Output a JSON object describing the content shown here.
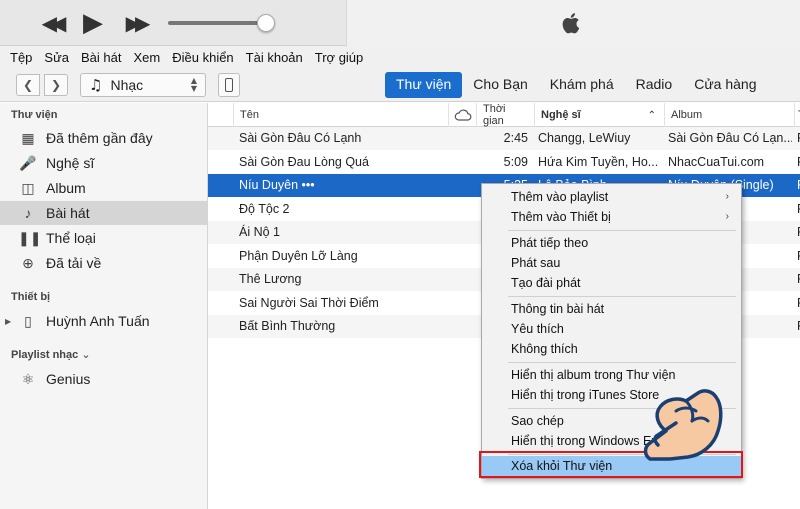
{
  "player": {
    "controls": [
      "rewind-icon",
      "play-icon",
      "fast-forward-icon"
    ],
    "volume_level": 0.88
  },
  "menu": [
    "Tệp",
    "Sửa",
    "Bài hát",
    "Xem",
    "Điều khiển",
    "Tài khoản",
    "Trợ giúp"
  ],
  "toolbar": {
    "media_type": "Nhạc",
    "tabs": [
      {
        "label": "Thư viện",
        "active": true
      },
      {
        "label": "Cho Bạn",
        "active": false
      },
      {
        "label": "Khám phá",
        "active": false
      },
      {
        "label": "Radio",
        "active": false
      },
      {
        "label": "Cửa hàng",
        "active": false
      }
    ]
  },
  "sidebar": {
    "library_title": "Thư viện",
    "library_items": [
      {
        "label": "Đã thêm gần đây",
        "icon": "calendar-icon"
      },
      {
        "label": "Nghệ sĩ",
        "icon": "microphone-icon"
      },
      {
        "label": "Album",
        "icon": "album-icon"
      },
      {
        "label": "Bài hát",
        "icon": "music-note-icon",
        "active": true
      },
      {
        "label": "Thể loại",
        "icon": "genre-icon"
      },
      {
        "label": "Đã tải về",
        "icon": "download-icon"
      }
    ],
    "devices_title": "Thiết bị",
    "device": {
      "label": "Huỳnh Anh Tuấn",
      "icon": "phone-icon"
    },
    "playlists_title": "Playlist nhạc",
    "playlists": [
      {
        "label": "Genius",
        "icon": "genius-icon"
      }
    ]
  },
  "table": {
    "columns": {
      "name": "Tên",
      "time": "Thời gian",
      "artist": "Nghệ sĩ",
      "album": "Album",
      "extra": "T"
    },
    "rows": [
      {
        "name": "Sài Gòn Đâu Có Lạnh",
        "time": "2:45",
        "artist": "Changg, LeWiuy",
        "album": "Sài Gòn Đâu Có Lạn...",
        "extra": "P"
      },
      {
        "name": "Sài Gòn Đau Lòng Quá",
        "time": "5:09",
        "artist": "Hứa Kim Tuyền, Ho...",
        "album": "NhacCuaTui.com",
        "extra": "P"
      },
      {
        "name": "Níu Duyên •••",
        "time": "5:35",
        "artist": "Lê Bảo Bình",
        "album": "Níu Duyên (Single)",
        "extra": "P",
        "selected": true
      },
      {
        "name": "Độ Tộc 2",
        "time": "",
        "artist": "",
        "album": "om",
        "extra": "P"
      },
      {
        "name": "Ái Nộ 1",
        "time": "",
        "artist": "",
        "album": "om",
        "extra": "P"
      },
      {
        "name": "Phận Duyên Lỡ Làng",
        "time": "",
        "artist": "",
        "album": "om",
        "extra": "P"
      },
      {
        "name": "Thê Lương",
        "time": "",
        "artist": "",
        "album": "om",
        "extra": "P"
      },
      {
        "name": "Sai Người Sai Thời Điểm",
        "time": "",
        "artist": "",
        "album": "Thời...",
        "extra": "P"
      },
      {
        "name": "Bất Bình Thường",
        "time": "",
        "artist": "",
        "album": "ông (Si...",
        "extra": "P"
      }
    ]
  },
  "context_menu": {
    "items": [
      {
        "label": "Thêm vào playlist",
        "submenu": "›"
      },
      {
        "label": "Thêm vào Thiết bị",
        "submenu": "›"
      },
      {
        "label": "Phát tiếp theo"
      },
      {
        "label": "Phát sau"
      },
      {
        "label": "Tạo đài phát"
      },
      {
        "label": "Thông tin bài hát"
      },
      {
        "label": "Yêu thích"
      },
      {
        "label": "Không thích"
      },
      {
        "label": "Hiển thị album trong Thư viện"
      },
      {
        "label": "Hiển thị trong iTunes Store"
      },
      {
        "label": "Sao chép"
      },
      {
        "label": "Hiển thị trong Windows Explorer"
      },
      {
        "label": "Xóa khỏi Thư viện",
        "highlighted": true
      }
    ]
  },
  "colors": {
    "accent": "#1a6dcd",
    "selection": "#1c68c6",
    "highlight": "#99c9f5",
    "callout": "#e0161b"
  }
}
